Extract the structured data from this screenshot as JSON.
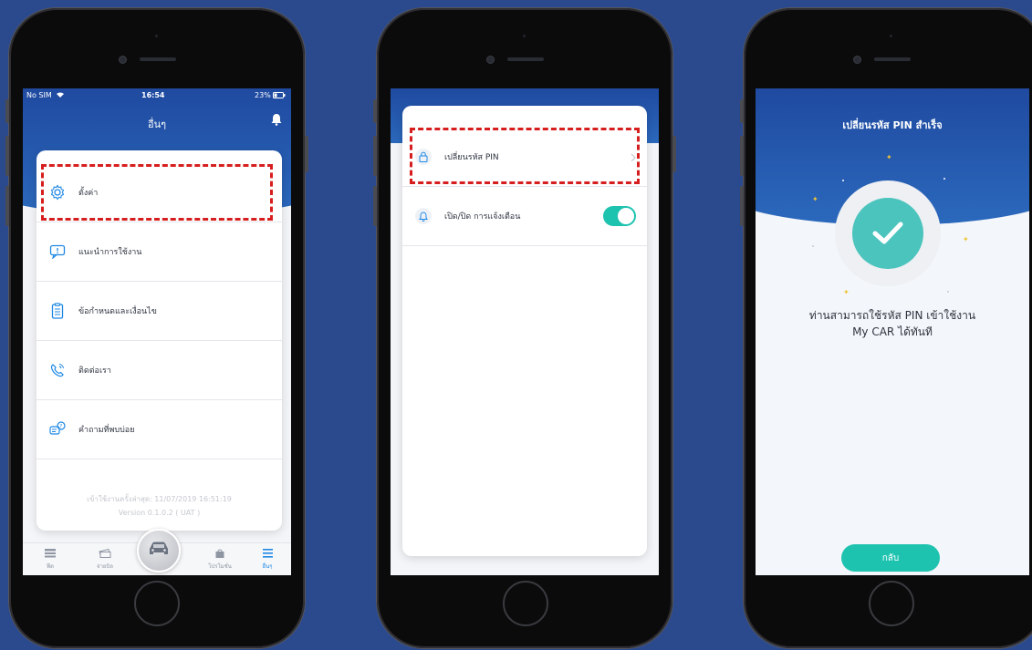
{
  "screen1": {
    "status": {
      "carrier": "No SIM",
      "time": "16:54",
      "battery": "23%"
    },
    "title": "อื่นๆ",
    "menu": [
      {
        "label": "ตั้งค่า",
        "icon": "gear-icon"
      },
      {
        "label": "แนะนำการใช้งาน",
        "icon": "guide-icon"
      },
      {
        "label": "ข้อกำหนดและเงื่อนไข",
        "icon": "document-icon"
      },
      {
        "label": "ติดต่อเรา",
        "icon": "phone-icon"
      },
      {
        "label": "คำถามที่พบบ่อย",
        "icon": "faq-icon"
      }
    ],
    "last_login": "เข้าใช้งานครั้งล่าสุด: 11/07/2019 16:51:19",
    "version": "Version 0.1.0.2 ( UAT )",
    "tabs": [
      {
        "label": "ฟีด",
        "icon": "feed-icon"
      },
      {
        "label": "จ่ายบิล",
        "icon": "bill-icon"
      },
      {
        "label": "โปรโมชั่น",
        "icon": "promotion-icon"
      },
      {
        "label": "อื่นๆ",
        "icon": "menu-icon"
      }
    ],
    "colors": {
      "accent": "#1e88e5",
      "highlight": "#d71e1e"
    }
  },
  "screen2": {
    "items": [
      {
        "label": "เปลี่ยนรหัส PIN",
        "icon": "lock-icon"
      },
      {
        "label": "เปิด/ปิด การแจ้งเตือน",
        "icon": "bell-icon",
        "toggle_on": true
      }
    ],
    "colors": {
      "toggle": "#1ec3b0"
    }
  },
  "screen3": {
    "title": "เปลี่ยนรหัส PIN สำเร็จ",
    "message_line1": "ท่านสามารถใช้รหัส PIN เข้าใช้งาน",
    "message_line2": "My CAR ได้ทันที",
    "back_button": "กลับ",
    "colors": {
      "check": "#4cc4be",
      "button": "#1ec3b0"
    }
  }
}
